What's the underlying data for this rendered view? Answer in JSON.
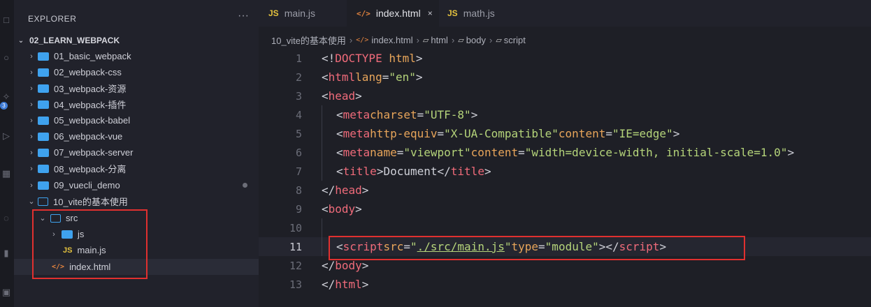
{
  "sidebar": {
    "header": "EXPLORER",
    "more": "···",
    "root": "02_LEARN_WEBPACK",
    "folders": [
      {
        "label": "01_basic_webpack"
      },
      {
        "label": "02_webpack-css"
      },
      {
        "label": "03_webpack-资源"
      },
      {
        "label": "04_webpack-插件"
      },
      {
        "label": "05_webpack-babel"
      },
      {
        "label": "06_webpack-vue"
      },
      {
        "label": "07_webpack-server"
      },
      {
        "label": "08_webpack-分离"
      },
      {
        "label": "09_vuecli_demo"
      }
    ],
    "open_folder": "10_vite的基本使用",
    "src": "src",
    "js_folder": "js",
    "main_js": "main.js",
    "index_html": "index.html"
  },
  "activity_badge": "3",
  "tabs": [
    {
      "label": "main.js",
      "icon": "JS",
      "active": false
    },
    {
      "label": "index.html",
      "icon": "</>",
      "active": true,
      "close": "×"
    },
    {
      "label": "math.js",
      "icon": "JS",
      "active": false
    }
  ],
  "breadcrumbs": [
    "10_vite的基本使用",
    "index.html",
    "html",
    "body",
    "script"
  ],
  "icons": {
    "js": "JS",
    "html": "</>"
  },
  "code": {
    "ln": [
      "1",
      "2",
      "3",
      "4",
      "5",
      "6",
      "7",
      "8",
      "9",
      "10",
      "11",
      "12",
      "13"
    ],
    "doctype_open": "<!",
    "doctype_kw": "DOCTYPE",
    "doctype_rest": " html",
    "close_bracket": ">",
    "l2_open": "<",
    "l2_tag": "html",
    "l2_attr": "lang",
    "l2_eq": "=",
    "l2_val": "\"en\"",
    "head_tag": "head",
    "meta": "meta",
    "charset": "charset",
    "charset_val": "\"UTF-8\"",
    "http_equiv": "http-equiv",
    "http_equiv_val": "\"X-UA-Compatible\"",
    "content": "content",
    "content_ie": "\"IE=edge\"",
    "name": "name",
    "name_val": "\"viewport\"",
    "content_vp": "\"width=device-width, initial-scale=1.0\"",
    "title": "title",
    "title_text": "Document",
    "body": "body",
    "script": "script",
    "src": "src",
    "src_q": "\"",
    "src_path": "./src/main.js",
    "type": "type",
    "type_val": "\"module\"",
    "html": "html",
    "lt": "<",
    "lts": "</",
    "eq": "="
  },
  "colors": {
    "tag": "#f06b7a",
    "attr": "#e8a55a",
    "string": "#b5d47a",
    "folder": "#3fa2ee",
    "highlight_box": "#e0302f"
  }
}
